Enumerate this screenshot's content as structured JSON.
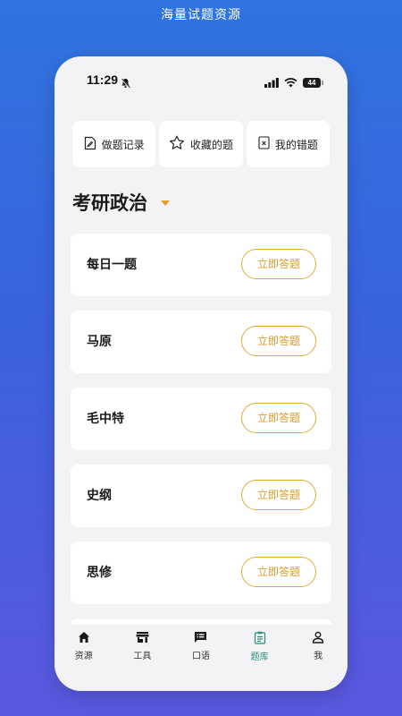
{
  "banner": {
    "title": "海量试题资源"
  },
  "status_bar": {
    "time": "11:29",
    "battery": "44"
  },
  "quick_actions": [
    {
      "label": "做题记录",
      "icon": "document-edit-icon"
    },
    {
      "label": "收藏的题",
      "icon": "star-icon"
    },
    {
      "label": "我的错题",
      "icon": "wrong-answer-icon"
    }
  ],
  "subject": {
    "title": "考研政治"
  },
  "categories": [
    {
      "name": "每日一题",
      "action": "立即答题"
    },
    {
      "name": "马原",
      "action": "立即答题"
    },
    {
      "name": "毛中特",
      "action": "立即答题"
    },
    {
      "name": "史纲",
      "action": "立即答题"
    },
    {
      "name": "思修",
      "action": "立即答题"
    }
  ],
  "tabbar": {
    "items": [
      {
        "label": "资源",
        "icon": "home-icon"
      },
      {
        "label": "工具",
        "icon": "store-icon"
      },
      {
        "label": "口语",
        "icon": "chat-icon"
      },
      {
        "label": "题库",
        "icon": "clipboard-icon",
        "active": true
      },
      {
        "label": "我",
        "icon": "person-icon"
      }
    ]
  },
  "colors": {
    "accent": "#e2a93a",
    "active_tab": "#2f8f77",
    "background_top": "#2f74e0",
    "background_bottom": "#5b58e0"
  }
}
